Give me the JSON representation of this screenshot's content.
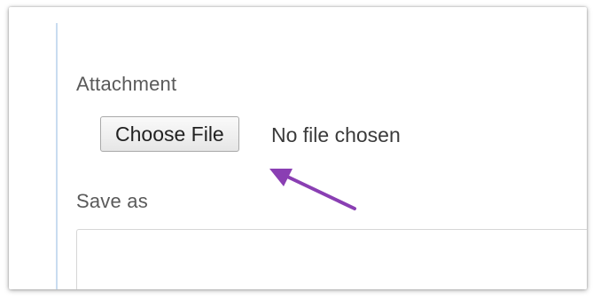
{
  "form": {
    "attachment_label": "Attachment",
    "choose_file_button": "Choose File",
    "file_status": "No file chosen",
    "save_as_label": "Save as",
    "save_as_value": ""
  },
  "annotation": {
    "arrow_color": "#8a3fb3"
  }
}
